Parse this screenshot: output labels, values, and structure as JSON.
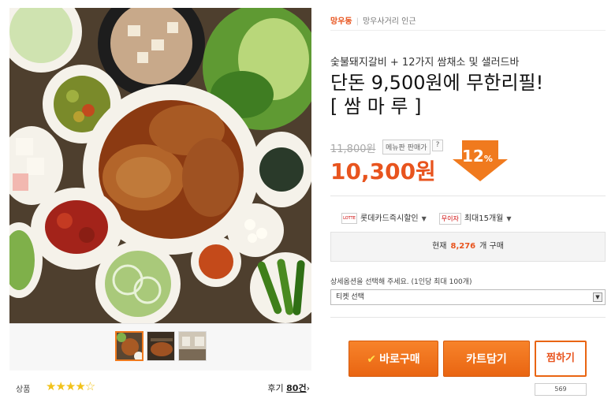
{
  "location": {
    "area": "망우동",
    "near": "망우사거리 인근"
  },
  "product": {
    "subtitle": "숯불돼지갈비 + 12가지 쌈채소 및 샐러드바",
    "title_line1": "단돈 9,500원에 무한리필!",
    "title_line2": "[ 쌈 마 루 ]",
    "original_price": "11,800원",
    "menu_badge": "메뉴판 판매가",
    "help_badge": "?",
    "sale_price": "10,300원",
    "discount": "12",
    "discount_unit": "%"
  },
  "card": {
    "logo": "LOTTE",
    "discount_label": "롯데카드즉시할인",
    "nointerest_badge": "무이자",
    "installment_label": "최대15개월"
  },
  "buyers": {
    "prefix": "현재",
    "count": "8,276",
    "suffix": "개 구매"
  },
  "option": {
    "label": "상세옵션을 선택해 주세요. (1인당 최대 100개)",
    "selected": "티켓 선택"
  },
  "buttons": {
    "buy": "바로구매",
    "buy_icon": "✔",
    "cart": "카트담기",
    "wish": "찜하기",
    "wish_count": "569"
  },
  "rating": {
    "label": "상품",
    "stars_filled": "★★★★",
    "stars_empty": "☆",
    "score": 4.5,
    "review_prefix": "후기",
    "review_count": "80건",
    "review_arrow": "›"
  },
  "colors": {
    "accent": "#e8541e",
    "button": "#f07a1e",
    "star": "#f2c21a"
  }
}
